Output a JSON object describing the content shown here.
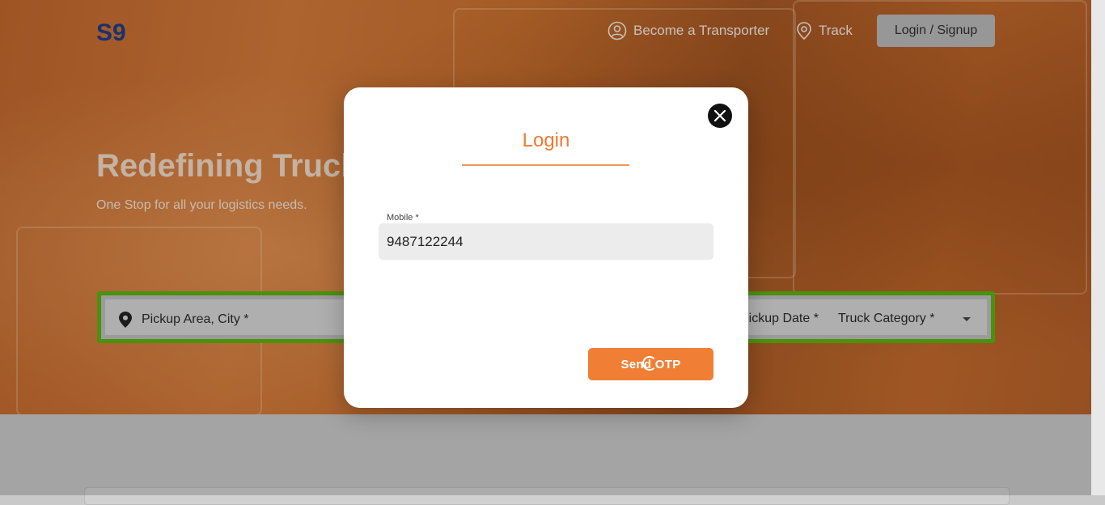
{
  "header": {
    "logo": "S9",
    "nav": [
      {
        "label": "Become a Transporter",
        "icon": "user-circle-icon"
      },
      {
        "label": "Track",
        "icon": "location-pin-icon"
      }
    ],
    "login_label": "Login / Signup"
  },
  "hero": {
    "title": "Redefining Trucking",
    "subtitle": "One Stop for all your logistics needs."
  },
  "search": {
    "pickup_placeholder": "Pickup Area, City *",
    "pickup_date_label": "Pickup Date *",
    "truck_category_label": "Truck Category *"
  },
  "modal": {
    "title": "Login",
    "mobile_label": "Mobile *",
    "mobile_value": "9487122244",
    "send_otp_label": "Send OTP",
    "loading": true
  },
  "colors": {
    "accent": "#f07f35",
    "logo": "#1f3e86",
    "search_border": "#5bb311"
  }
}
